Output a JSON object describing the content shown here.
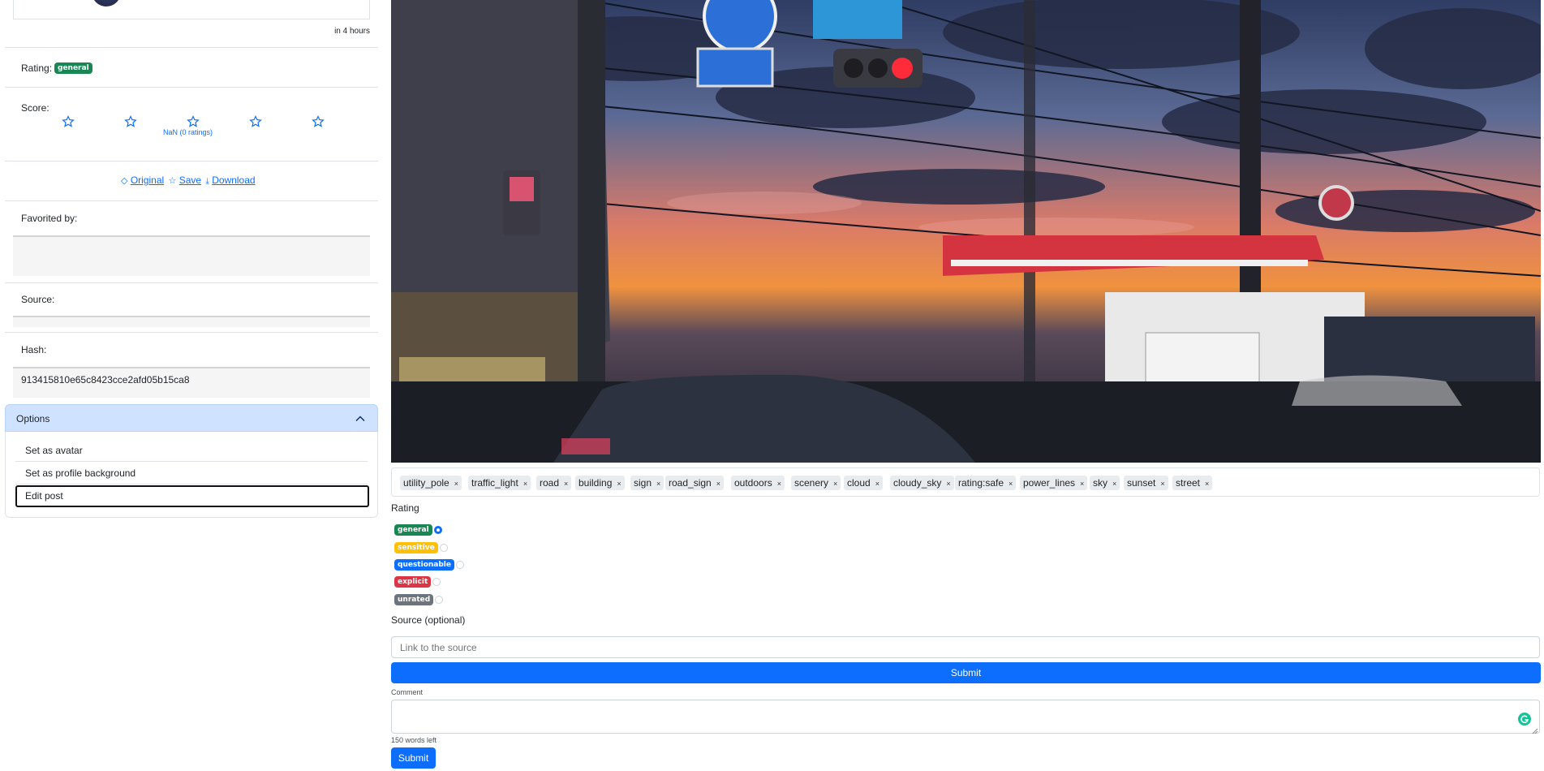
{
  "sidebar": {
    "time_text": "in 4 hours",
    "rating": {
      "label": "Rating:",
      "value": "general"
    },
    "score": {
      "label": "Score:",
      "value_text": "NaN (0 ratings)",
      "stars": 5
    },
    "links": {
      "original": "Original",
      "save": "Save",
      "download": "Download"
    },
    "favorited_label": "Favorited by:",
    "source_label": "Source:",
    "hash_label": "Hash:",
    "hash_value": "913415810e65c8423cce2afd05b15ca8",
    "options": {
      "title": "Options",
      "items": [
        "Set as avatar",
        "Set as profile background",
        "Edit post"
      ]
    }
  },
  "main": {
    "tags": [
      "utility_pole",
      "traffic_light",
      "road",
      "building",
      "sign",
      "road_sign",
      "outdoors",
      "scenery",
      "cloud",
      "cloudy_sky",
      "rating:safe",
      "power_lines",
      "sky",
      "sunset",
      "street"
    ],
    "tag_remove_glyph": "×",
    "rating_label": "Rating",
    "rating_options": [
      "general",
      "sensitive",
      "questionable",
      "explicit",
      "unrated"
    ],
    "rating_selected": "general",
    "source_label": "Source (optional)",
    "source_placeholder": "Link to the source",
    "submit_label": "Submit",
    "comment_label": "Comment",
    "words_left": "150 words left",
    "comment_submit_label": "Submit"
  },
  "colors": {
    "primary": "#0d6efd",
    "general": "#198754",
    "sensitive": "#ffc107",
    "questionable": "#0d6efd",
    "explicit": "#dc3545",
    "unrated": "#6c757d",
    "options_header": "#cfe2ff"
  }
}
